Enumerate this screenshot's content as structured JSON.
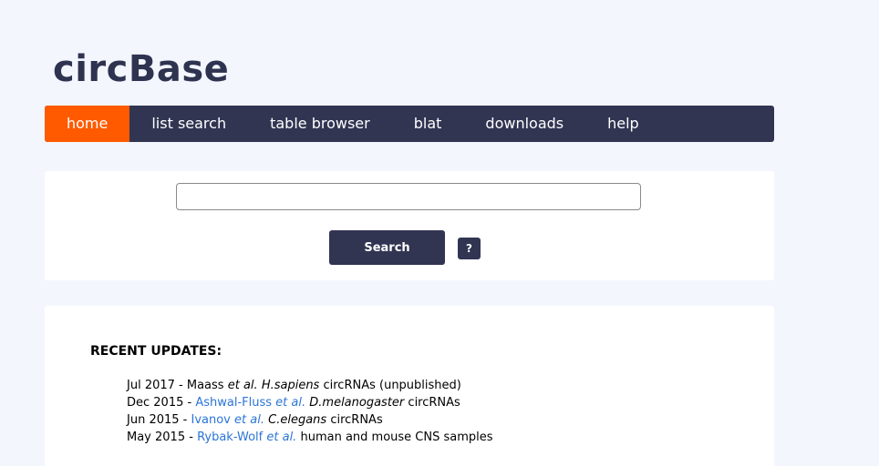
{
  "header": {
    "logo_text": "circBase"
  },
  "nav": {
    "items": [
      {
        "label": "home",
        "active": true
      },
      {
        "label": "list search"
      },
      {
        "label": "table browser"
      },
      {
        "label": "blat"
      },
      {
        "label": "downloads"
      },
      {
        "label": "help"
      }
    ]
  },
  "search": {
    "input_value": "",
    "button_label": "Search",
    "help_label": "?"
  },
  "updates": {
    "title": "RECENT UPDATES:",
    "items": [
      {
        "date": "Jul 2017",
        "sep": " - ",
        "author": "Maass",
        "etal": "et al.",
        "species": "H.sapiens",
        "desc": "circRNAs (unpublished)",
        "linked": false
      },
      {
        "date": "Dec 2015",
        "sep": " - ",
        "author": "Ashwal-Fluss",
        "etal": "et al.",
        "species": "D.melanogaster",
        "desc": "circRNAs",
        "linked": true
      },
      {
        "date": "Jun 2015",
        "sep": " - ",
        "author": "Ivanov",
        "etal": "et al.",
        "species": "C.elegans",
        "desc": "circRNAs",
        "linked": true
      },
      {
        "date": "May 2015",
        "sep": " - ",
        "author": "Rybak-Wolf",
        "etal": "et al.",
        "species": "",
        "desc": "human and mouse CNS samples",
        "linked": true
      }
    ]
  },
  "colors": {
    "accent": "#ff5a00",
    "nav_bg": "#313552",
    "link": "#2b75d6",
    "page_bg": "#f3f6fd"
  }
}
